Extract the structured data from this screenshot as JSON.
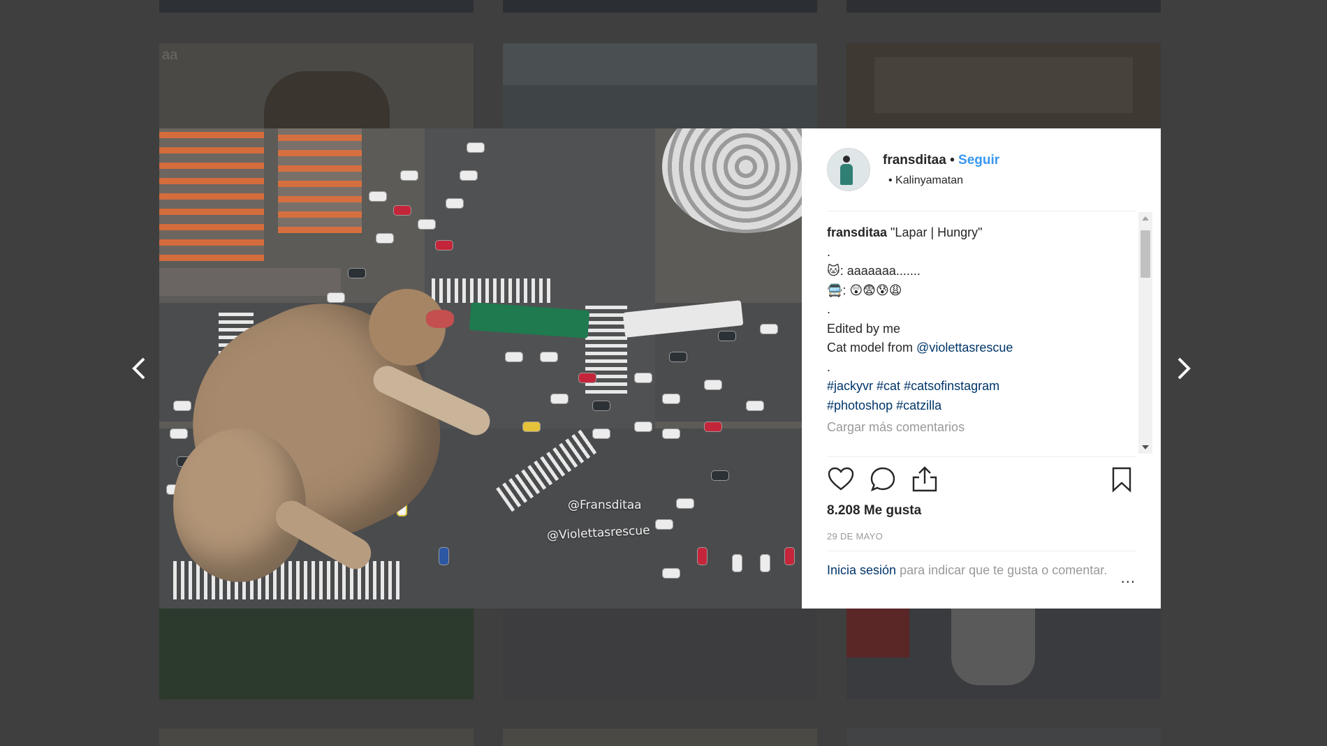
{
  "background_grid": {
    "tile_texts": [
      "aa",
      "",
      ""
    ]
  },
  "post": {
    "username": "fransditaa",
    "separator": "•",
    "follow_label": "Seguir",
    "location": "• Kalinyamatan",
    "caption_user": "fransditaa",
    "caption_lines": [
      "\"Lapar | Hungry\"",
      ".",
      "🐱: aaaaaaa.......",
      "🚍: 😲😨😰😩",
      ".",
      "Edited by me"
    ],
    "model_prefix": "Cat model from ",
    "model_link": "@violettasrescue",
    "dot_line": ".",
    "hashtags_line1": [
      "#jackyvr",
      "#cat",
      "#catsofinstagram"
    ],
    "hashtags_line2": [
      "#photoshop",
      "#catzilla"
    ],
    "load_more": "Cargar más comentarios",
    "likes": "8.208 Me gusta",
    "date": "29 DE MAYO",
    "login_link": "Inicia sesión",
    "login_text": " para indicar que te gusta o comentar.",
    "more_dots": "..."
  },
  "photo": {
    "watermark_1": "@Fransditaa",
    "watermark_2": "@Violettasrescue"
  },
  "icons": {
    "like": "heart-icon",
    "comment": "speech-bubble-icon",
    "share": "share-icon",
    "save": "bookmark-icon",
    "prev": "chevron-left-icon",
    "next": "chevron-right-icon"
  },
  "colors": {
    "link": "#003569",
    "follow": "#3897f0",
    "text": "#262626",
    "muted": "#999999",
    "backdrop": "#3f3f3f"
  }
}
